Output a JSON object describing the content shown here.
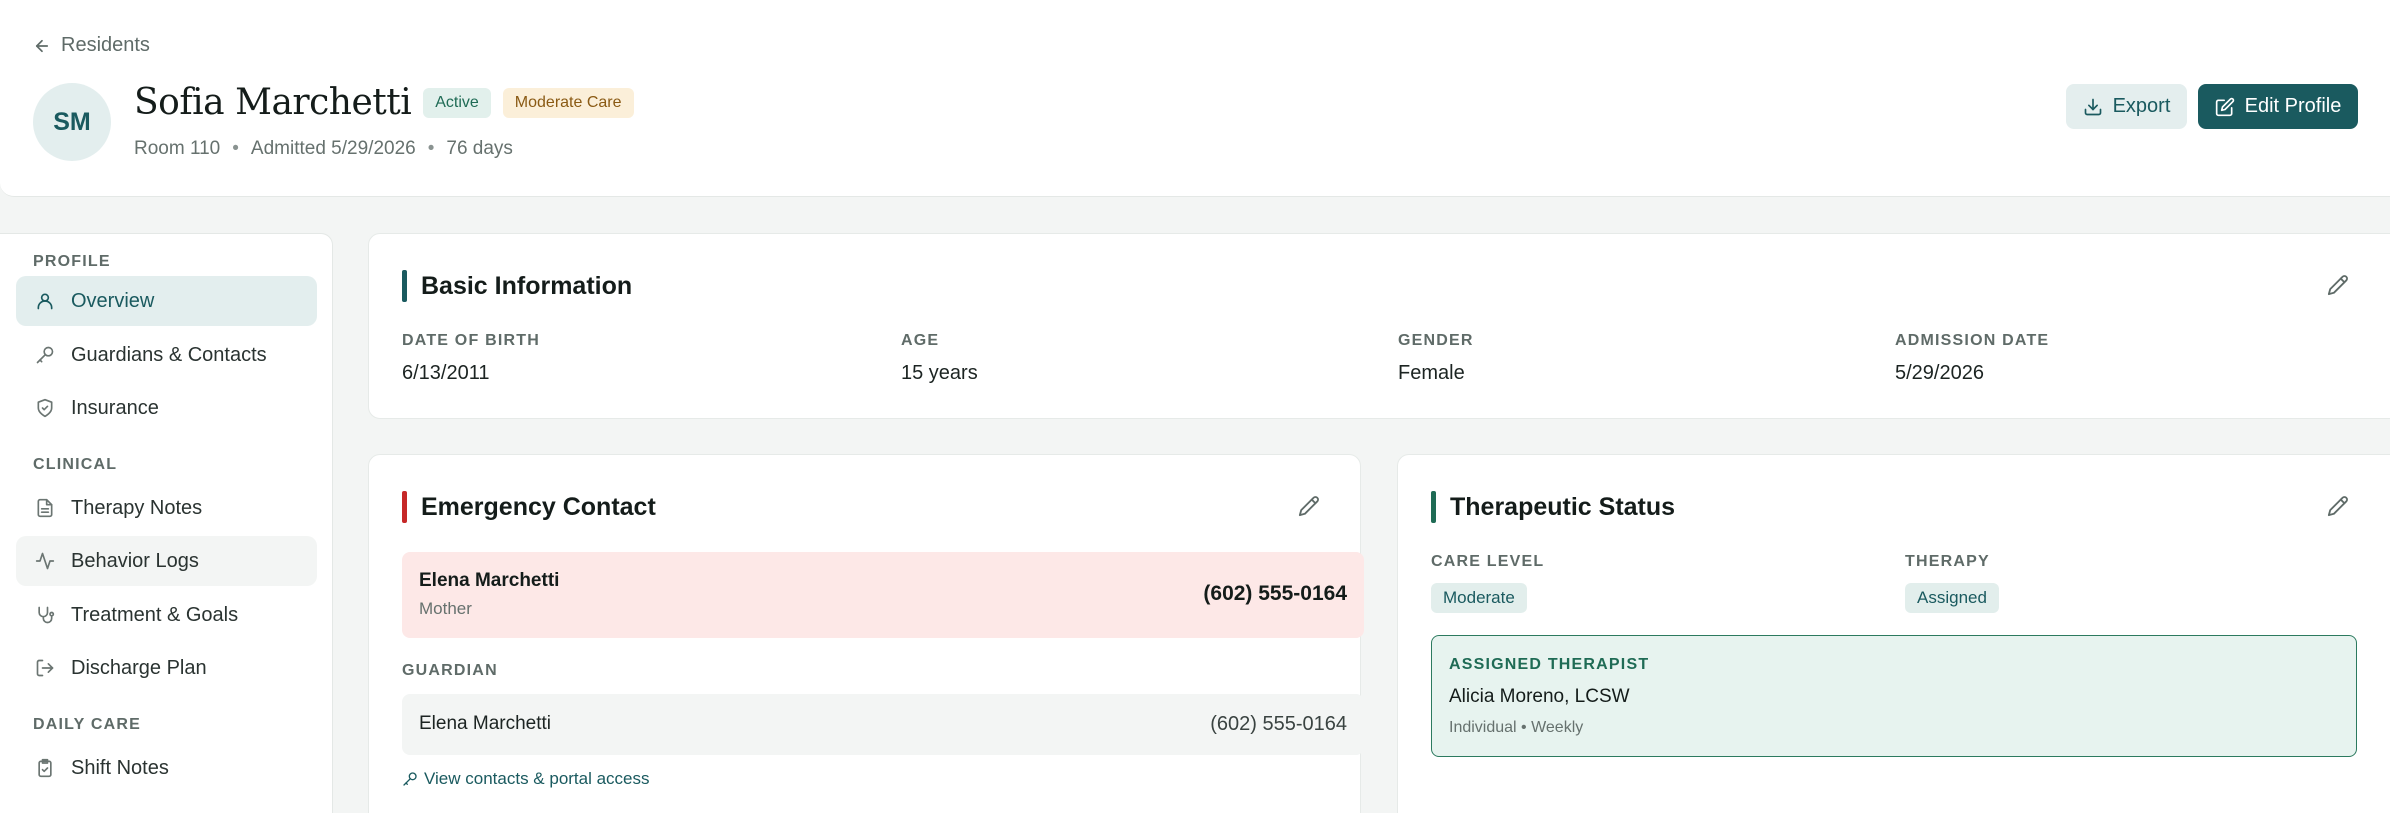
{
  "header": {
    "back_label": "Residents",
    "avatar_initials": "SM",
    "name": "Sofia Marchetti",
    "status_badge": "Active",
    "care_badge": "Moderate Care",
    "room": "Room 110",
    "admitted": "Admitted 5/29/2026",
    "days": "76 days",
    "meta_separator": "•",
    "export_label": "Export",
    "edit_label": "Edit Profile"
  },
  "sidebar": {
    "sections": [
      {
        "label": "PROFILE",
        "items": [
          {
            "label": "Overview",
            "icon": "user-icon",
            "active": true
          },
          {
            "label": "Guardians & Contacts",
            "icon": "key-icon"
          },
          {
            "label": "Insurance",
            "icon": "shield-check-icon"
          }
        ]
      },
      {
        "label": "CLINICAL",
        "items": [
          {
            "label": "Therapy Notes",
            "icon": "file-text-icon"
          },
          {
            "label": "Behavior Logs",
            "icon": "activity-icon",
            "hover": true
          },
          {
            "label": "Treatment & Goals",
            "icon": "stethoscope-icon"
          },
          {
            "label": "Discharge Plan",
            "icon": "log-out-icon"
          }
        ]
      },
      {
        "label": "DAILY CARE",
        "items": [
          {
            "label": "Shift Notes",
            "icon": "clipboard-check-icon"
          }
        ]
      }
    ]
  },
  "basic_info": {
    "title": "Basic Information",
    "fields": [
      {
        "label": "DATE OF BIRTH",
        "value": "6/13/2011"
      },
      {
        "label": "AGE",
        "value": "15 years"
      },
      {
        "label": "GENDER",
        "value": "Female"
      },
      {
        "label": "ADMISSION DATE",
        "value": "5/29/2026"
      }
    ]
  },
  "emergency": {
    "title": "Emergency Contact",
    "contact_name": "Elena Marchetti",
    "contact_relation": "Mother",
    "contact_phone": "(602) 555-0164",
    "guardian_label": "GUARDIAN",
    "guardian_name": "Elena Marchetti",
    "guardian_phone": "(602) 555-0164",
    "link_label": "View contacts & portal access"
  },
  "therapeutic": {
    "title": "Therapeutic Status",
    "care_level_label": "CARE LEVEL",
    "care_level_value": "Moderate",
    "therapy_label": "THERAPY",
    "therapy_value": "Assigned",
    "therapist_heading": "ASSIGNED THERAPIST",
    "therapist_name": "Alicia Moreno, LCSW",
    "therapist_detail": "Individual • Weekly"
  },
  "colors": {
    "accent": "#1a5a5f",
    "emergency_bar": "#c62828",
    "therapeutic_bar": "#1f6b55",
    "background": "#f3f5f4"
  }
}
